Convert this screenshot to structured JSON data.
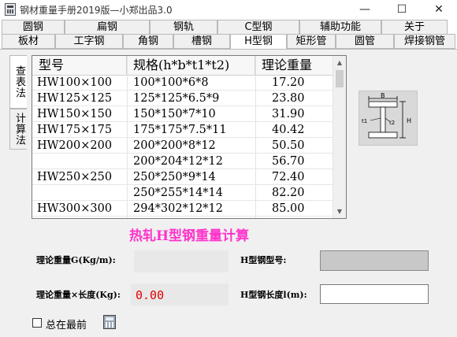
{
  "window": {
    "title": "钢材重量手册2019版—小郑出品3.0",
    "minimize_glyph": "—",
    "maximize_glyph": "☐",
    "close_glyph": "✕"
  },
  "tabs_row1": [
    "圆钢",
    "扁钢",
    "钢轨",
    "C型钢",
    "辅助功能",
    "关于"
  ],
  "tabs_row2": [
    "板材",
    "工字钢",
    "角钢",
    "槽钢",
    "H型钢",
    "矩形管",
    "圆管",
    "焊接钢管"
  ],
  "active_tab": "H型钢",
  "side_tabs": [
    "查表法",
    "计算法"
  ],
  "table": {
    "headers": [
      "型号",
      "规格(h*b*t1*t2)",
      "理论重量"
    ],
    "rows": [
      [
        "HW100×100",
        "100*100*6*8",
        "17.20"
      ],
      [
        "HW125×125",
        "125*125*6.5*9",
        "23.80"
      ],
      [
        "HW150×150",
        "150*150*7*10",
        "31.90"
      ],
      [
        "HW175×175",
        "175*175*7.5*11",
        "40.42"
      ],
      [
        "HW200×200",
        "200*200*8*12",
        "50.50"
      ],
      [
        "",
        "200*204*12*12",
        "56.70"
      ],
      [
        "HW250×250",
        "250*250*9*14",
        "72.40"
      ],
      [
        "",
        "250*255*14*14",
        "82.20"
      ],
      [
        "HW300×300",
        "294*302*12*12",
        "85.00"
      ]
    ]
  },
  "diagram_labels": {
    "b": "B",
    "t1": "t1",
    "t2": "t2",
    "h": "H"
  },
  "form": {
    "heading": "热轧H型钢重量计算",
    "weight_label": "理论重量G(Kg/m):",
    "weight_length_label": "理论重量×长度(Kg):",
    "weight_length_value": "0.00",
    "model_label": "H型钢型号:",
    "length_label": "H型钢长度l(m):",
    "length_value": ""
  },
  "footer": {
    "always_on_top_label": "总在最前"
  },
  "colors": {
    "heading": "#ff33cc",
    "result_value": "#e00000",
    "panel_bg": "#f0f0f0"
  }
}
